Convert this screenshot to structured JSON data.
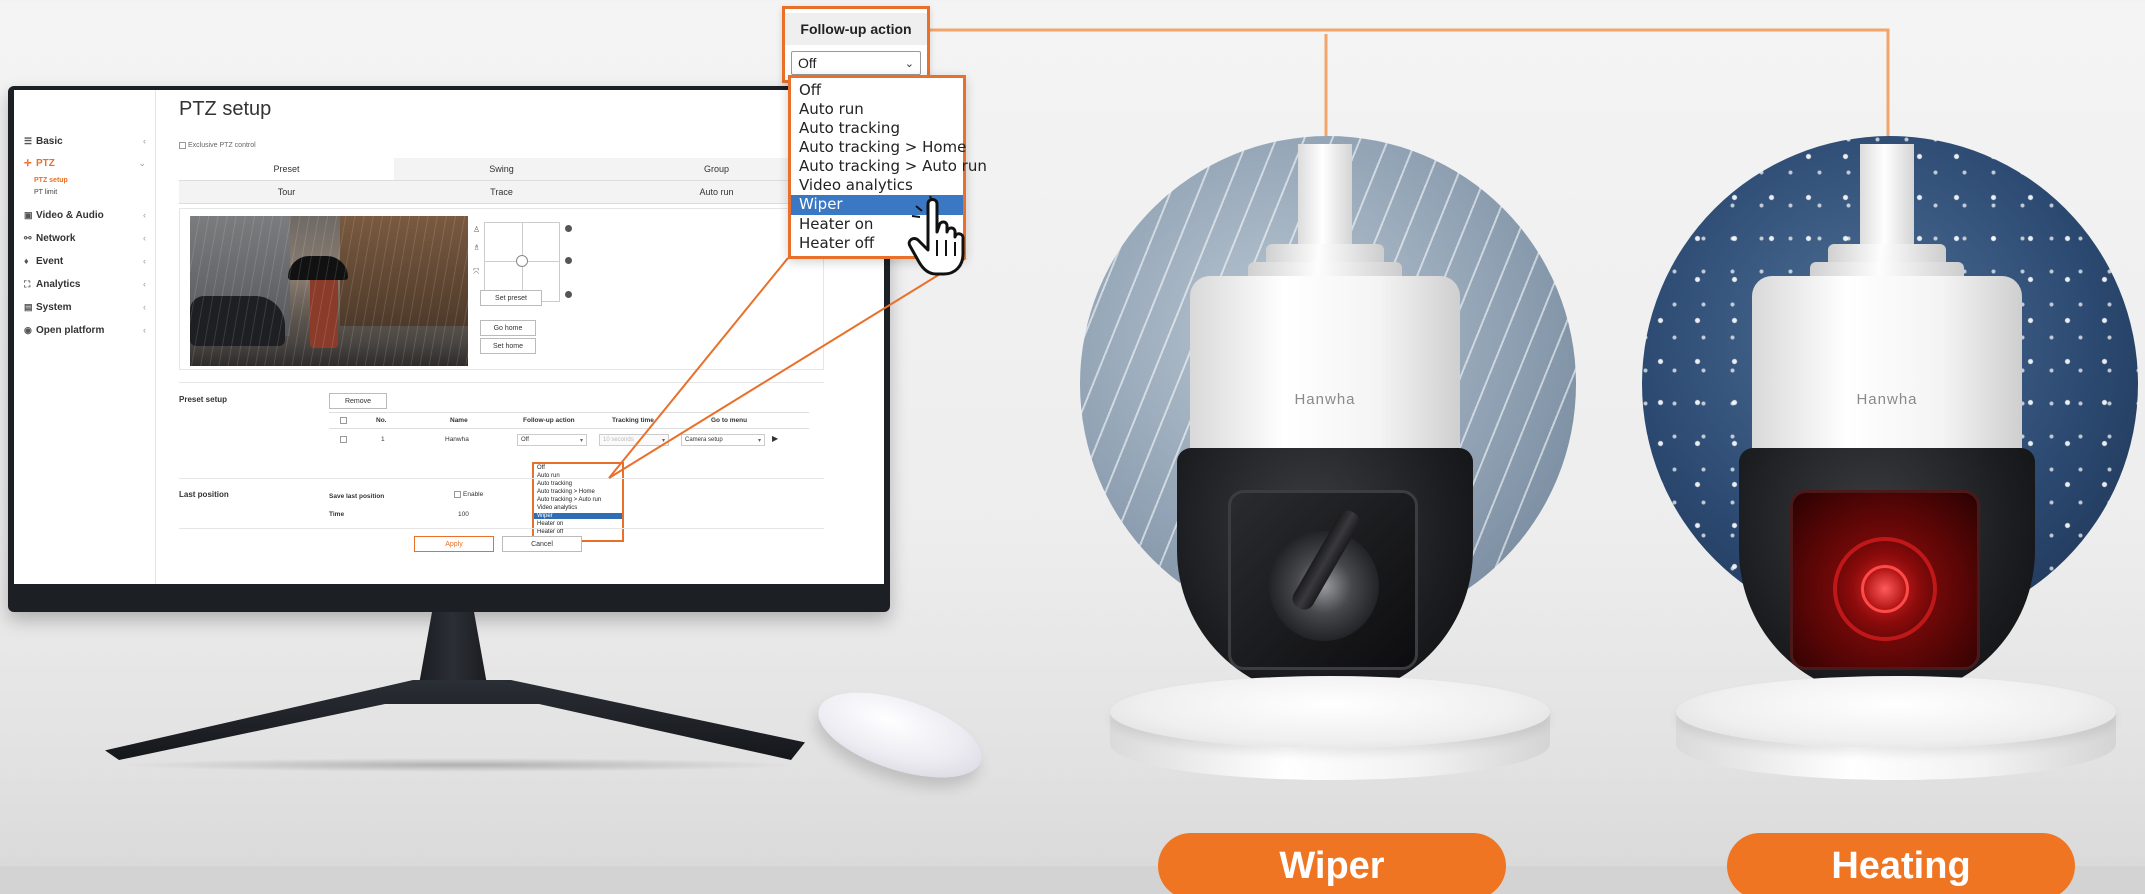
{
  "colors": {
    "accent": "#ef7523",
    "highlight": "#3b78c4",
    "sidebar_active": "#e8702a"
  },
  "web_ui": {
    "page_title": "PTZ setup",
    "sidebar": {
      "items": [
        {
          "icon": "list-icon",
          "label": "Basic"
        },
        {
          "icon": "ptz-icon",
          "label": "PTZ"
        },
        {
          "icon": "video-icon",
          "label": "Video & Audio"
        },
        {
          "icon": "network-icon",
          "label": "Network"
        },
        {
          "icon": "event-icon",
          "label": "Event"
        },
        {
          "icon": "analytics-icon",
          "label": "Analytics"
        },
        {
          "icon": "system-icon",
          "label": "System"
        },
        {
          "icon": "platform-icon",
          "label": "Open platform"
        }
      ],
      "sub_items": [
        "PTZ setup",
        "PT limit"
      ]
    },
    "exclusive_label": "Exclusive PTZ control",
    "tabs_row1": [
      "Preset",
      "Swing",
      "Group"
    ],
    "tabs_row2": [
      "Tour",
      "Trace",
      "Auto run"
    ],
    "buttons": {
      "set_preset": "Set preset",
      "go_home": "Go home",
      "set_home": "Set home",
      "remove": "Remove",
      "apply": "Apply",
      "cancel": "Cancel"
    },
    "preset_setup": {
      "label": "Preset setup",
      "headers": [
        "No.",
        "Name",
        "Follow-up action",
        "Tracking time",
        "Go to menu"
      ],
      "row": {
        "no": "1",
        "name": "Hanwha",
        "follow_up": "Off",
        "tracking_time": "10 seconds",
        "go_to_menu": "Camera setup"
      }
    },
    "mini_dropdown_options": [
      "Off",
      "Auto run",
      "Auto tracking",
      "Auto tracking > Home",
      "Auto tracking > Auto run",
      "Video analytics",
      "Wiper",
      "Heater on",
      "Heater off"
    ],
    "mini_dropdown_selected": "Wiper",
    "last_position": {
      "label": "Last position",
      "save_label": "Save last position",
      "enable_label": "Enable",
      "time_label": "Time",
      "time_value": "100"
    }
  },
  "callout": {
    "title": "Follow-up action",
    "selected_value": "Off",
    "options": [
      "Off",
      "Auto run",
      "Auto tracking",
      "Auto tracking > Home",
      "Auto tracking > Auto run",
      "Video analytics",
      "Wiper",
      "Heater on",
      "Heater off"
    ],
    "highlighted": "Wiper"
  },
  "cameras": [
    {
      "brand": "Hanwha",
      "label": "Wiper",
      "scene": "rain"
    },
    {
      "brand": "Hanwha",
      "label": "Heating",
      "scene": "snow"
    }
  ]
}
